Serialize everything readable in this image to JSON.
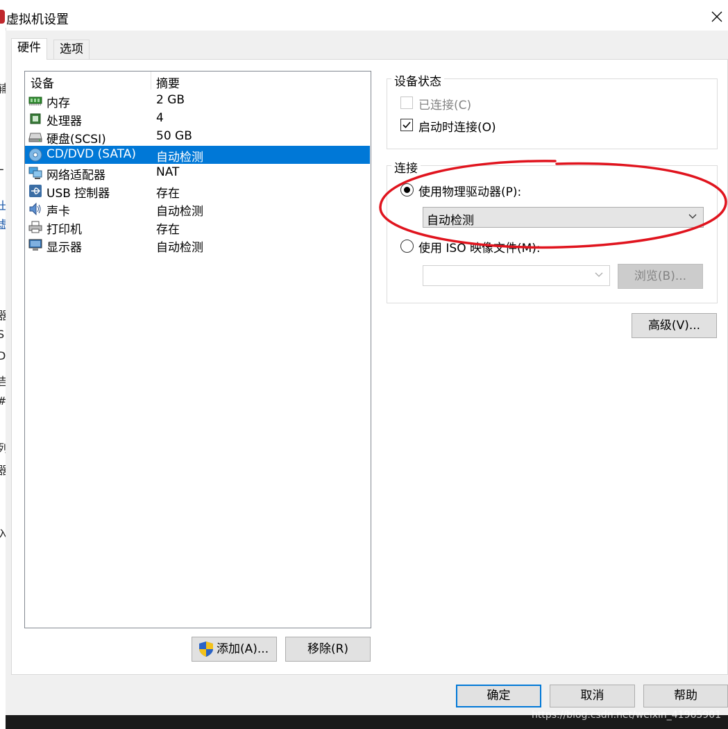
{
  "window": {
    "title": "虚拟机设置"
  },
  "tabs": [
    {
      "label": "硬件"
    },
    {
      "label": "选项"
    }
  ],
  "device_list": {
    "columns": [
      "设备",
      "摘要"
    ],
    "rows": [
      {
        "name": "内存",
        "summary": "2 GB",
        "icon": "memory-icon"
      },
      {
        "name": "处理器",
        "summary": "4",
        "icon": "processor-icon"
      },
      {
        "name": "硬盘(SCSI)",
        "summary": "50 GB",
        "icon": "hard-disk-icon"
      },
      {
        "name": "CD/DVD (SATA)",
        "summary": "自动检测",
        "icon": "cd-dvd-icon",
        "selected": true
      },
      {
        "name": "网络适配器",
        "summary": "NAT",
        "icon": "network-adapter-icon"
      },
      {
        "name": "USB 控制器",
        "summary": "存在",
        "icon": "usb-icon"
      },
      {
        "name": "声卡",
        "summary": "自动检测",
        "icon": "sound-card-icon"
      },
      {
        "name": "打印机",
        "summary": "存在",
        "icon": "printer-icon"
      },
      {
        "name": "显示器",
        "summary": "自动检测",
        "icon": "display-icon"
      }
    ],
    "add_label": "添加(A)...",
    "remove_label": "移除(R)"
  },
  "device_status": {
    "title": "设备状态",
    "connected_label": "已连接(C)",
    "connected_checked": false,
    "connect_at_power_on_label": "启动时连接(O)",
    "connect_at_power_on_checked": true
  },
  "connection": {
    "title": "连接",
    "physical_drive_label": "使用物理驱动器(P):",
    "physical_drive_value": "自动检测",
    "iso_label": "使用 ISO 映像文件(M):",
    "iso_value": "",
    "browse_label": "浏览(B)...",
    "selected": "physical"
  },
  "advanced_label": "高级(V)...",
  "footer": {
    "ok_label": "确定",
    "cancel_label": "取消",
    "help_label": "帮助"
  },
  "watermark": "https://blog.csdn.net/weixin_41965901",
  "background_glyphs": [
    "辅",
    "L",
    "出",
    "虚",
    "器",
    "S",
    "D",
    "吉",
    "#",
    "列",
    "器",
    "入"
  ],
  "colors": {
    "selection": "#0078d7",
    "annotation": "#e0141e",
    "dialog_bg": "#f0f0f0"
  }
}
